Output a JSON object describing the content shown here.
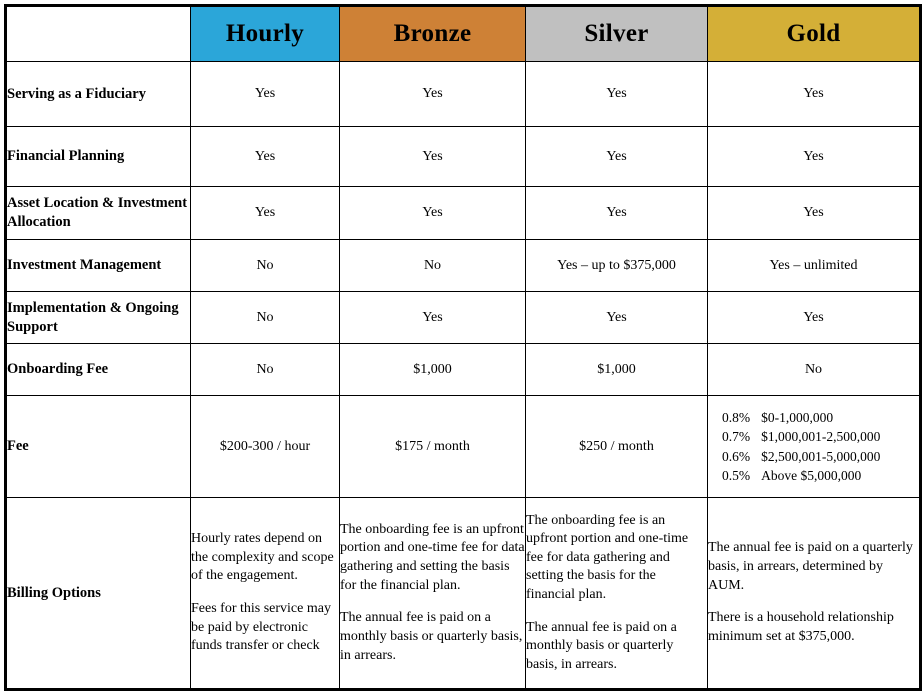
{
  "colors": {
    "hourly": "#2BA6D9",
    "bronze": "#CE8136",
    "silver": "#C0C0C0",
    "gold": "#D4AF37",
    "border": "#000000",
    "background": "#FFFFFF"
  },
  "table": {
    "corner_label": "",
    "columns": [
      {
        "key": "hourly",
        "label": "Hourly"
      },
      {
        "key": "bronze",
        "label": "Bronze"
      },
      {
        "key": "silver",
        "label": "Silver"
      },
      {
        "key": "gold",
        "label": "Gold"
      }
    ],
    "rows": [
      {
        "label": "Serving as a Fiduciary",
        "cells": [
          "Yes",
          "Yes",
          "Yes",
          "Yes"
        ]
      },
      {
        "label": "Financial Planning",
        "cells": [
          "Yes",
          "Yes",
          "Yes",
          "Yes"
        ]
      },
      {
        "label": "Asset Location & Investment Allocation",
        "cells": [
          "Yes",
          "Yes",
          "Yes",
          "Yes"
        ]
      },
      {
        "label": "Investment Management",
        "cells": [
          "No",
          "No",
          "Yes – up to $375,000",
          "Yes – unlimited"
        ]
      },
      {
        "label": "Implementation & Ongoing Support",
        "cells": [
          "No",
          "Yes",
          "Yes",
          "Yes"
        ]
      },
      {
        "label": "Onboarding Fee",
        "cells": [
          "No",
          "$1,000",
          "$1,000",
          "No"
        ]
      },
      {
        "label": "Fee",
        "cells": [
          "$200-300 / hour",
          "$175 / month",
          "$250 / month",
          ""
        ]
      },
      {
        "label": "Billing Options",
        "cells": [
          "",
          "",
          "",
          ""
        ]
      }
    ]
  },
  "gold_fee_tiers": [
    {
      "rate": "0.8%",
      "range": "$0-1,000,000"
    },
    {
      "rate": "0.7%",
      "range": "$1,000,001-2,500,000"
    },
    {
      "rate": "0.6%",
      "range": "$2,500,001-5,000,000"
    },
    {
      "rate": "0.5%",
      "range": "Above $5,000,000"
    }
  ],
  "billing_options": {
    "hourly": {
      "p1": "Hourly rates depend on the complexity and scope of the engagement.",
      "p2": "Fees for this service may be paid by electronic funds transfer or check"
    },
    "bronze": {
      "p1": "The onboarding fee is an upfront portion and one-time fee for data gathering and setting the basis for the financial plan.",
      "p2": "The annual fee is paid on a monthly basis or quarterly basis, in arrears."
    },
    "silver": {
      "p1": "The onboarding fee is an upfront portion and one-time fee for data gathering and setting the basis for the financial plan.",
      "p2": "The annual fee is paid on a monthly basis or quarterly basis, in arrears."
    },
    "gold": {
      "p1": "The annual fee is paid on a quarterly basis, in arrears, determined by AUM.",
      "p2": "There is a household relationship minimum set at $375,000."
    }
  }
}
